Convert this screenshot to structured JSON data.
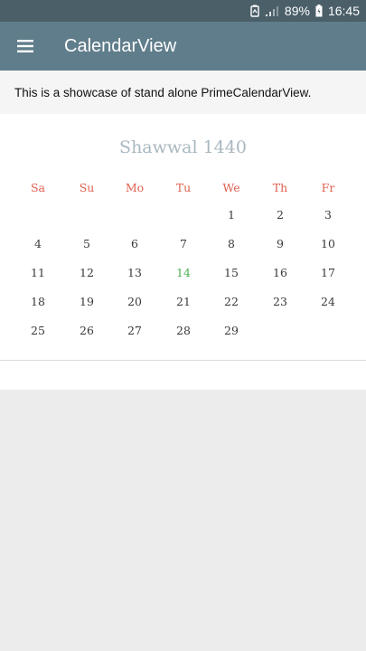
{
  "status_bar": {
    "battery": "89%",
    "time": "16:45",
    "icons": [
      "sync-icon",
      "signal-icon",
      "battery-icon"
    ]
  },
  "app_bar": {
    "title": "CalendarView",
    "menu_icon": "hamburger-menu-icon",
    "color": "#607d8b"
  },
  "description": "This is a showcase of stand alone PrimeCalendarView.",
  "calendar": {
    "month_title": "Shawwal 1440",
    "weekdays": [
      "Sa",
      "Su",
      "Mo",
      "Tu",
      "We",
      "Th",
      "Fr"
    ],
    "weekday_color": "#e0604f",
    "today": "14",
    "today_color": "#4caf50",
    "weeks": [
      [
        "",
        "",
        "",
        "",
        "1",
        "2",
        "3"
      ],
      [
        "4",
        "5",
        "6",
        "7",
        "8",
        "9",
        "10"
      ],
      [
        "11",
        "12",
        "13",
        "14",
        "15",
        "16",
        "17"
      ],
      [
        "18",
        "19",
        "20",
        "21",
        "22",
        "23",
        "24"
      ],
      [
        "25",
        "26",
        "27",
        "28",
        "29",
        "",
        ""
      ]
    ]
  }
}
